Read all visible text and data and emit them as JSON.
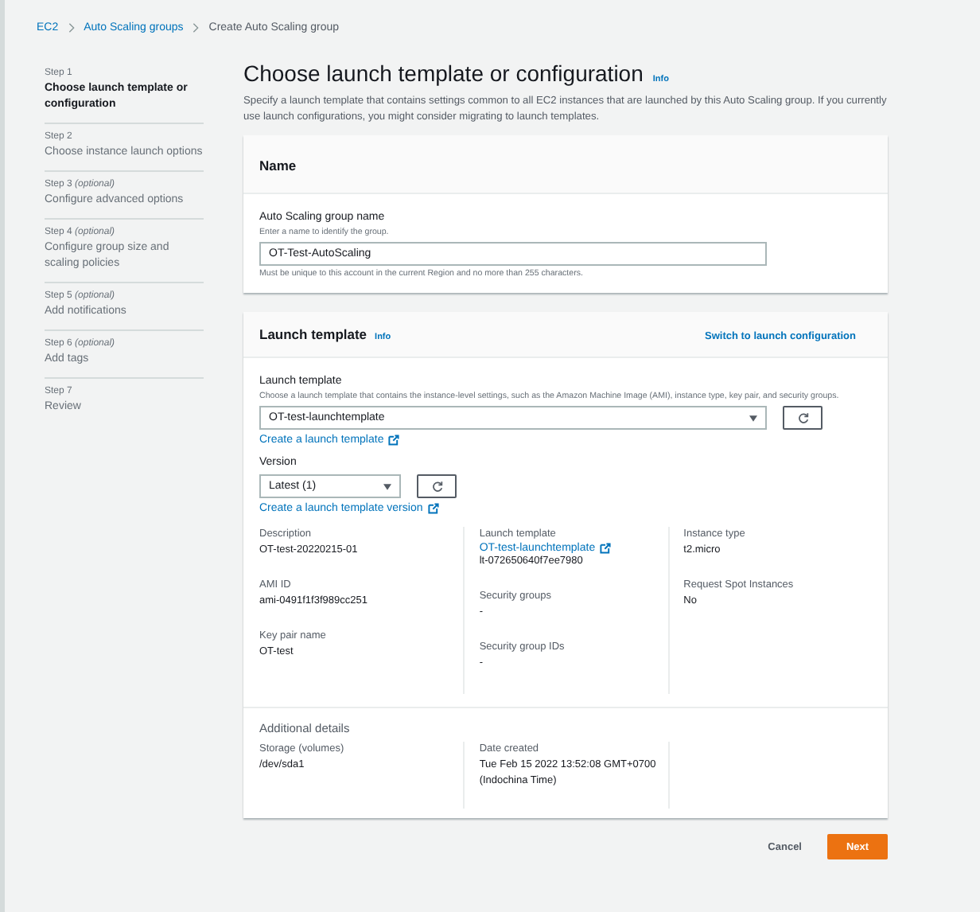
{
  "breadcrumb": [
    {
      "label": "EC2",
      "kind": "link"
    },
    {
      "label": "Auto Scaling groups",
      "kind": "link"
    },
    {
      "label": "Create Auto Scaling group",
      "kind": "current"
    }
  ],
  "steps": [
    {
      "step": "Step 1",
      "title": "Choose launch template or configuration",
      "selected": true
    },
    {
      "step": "Step 2",
      "title": "Choose instance launch options",
      "selected": false
    },
    {
      "step": "Step 3 *(optional)*",
      "title": "Configure advanced options",
      "selected": false
    },
    {
      "step": "Step 4 *(optional)*",
      "title": "Configure group size and scaling policies",
      "selected": false
    },
    {
      "step": "Step 5 *(optional)*",
      "title": "Add notifications",
      "selected": false
    },
    {
      "step": "Step 6 *(optional)*",
      "title": "Add tags",
      "selected": false
    },
    {
      "step": "Step 7",
      "title": "Review",
      "selected": false
    }
  ],
  "page": {
    "title": "Choose launch template or configuration",
    "info": "Info",
    "description": "Specify a launch template that contains settings common to all EC2 instances that are launched by this Auto Scaling group. If you currently use launch configurations, you might consider migrating to launch templates."
  },
  "name_card": {
    "title": "Name",
    "label": "Auto Scaling group name",
    "hint": "Enter a name to identify the group.",
    "value": "OT-Test-AutoScaling",
    "constraint": "Must be unique to this account in the current Region and no more than 255 characters."
  },
  "template_card": {
    "title": "Launch template",
    "info": "Info",
    "switch_link": "Switch to launch configuration",
    "template_label": "Launch template",
    "template_hint": "Choose a launch template that contains the instance-level settings, such as the Amazon Machine Image (AMI), instance type, key pair, and security groups.",
    "template_value": "OT-test-launchtemplate",
    "create_link": "Create a launch template",
    "version_label": "Version",
    "version_value": "Latest (1)",
    "version_link": "Create a launch template version",
    "details": [
      [
        {
          "label": "Description",
          "value": "OT-test-20220215-01",
          "kind": "text"
        },
        {
          "label": "AMI ID",
          "value": "ami-0491f1f3f989cc251",
          "kind": "text"
        },
        {
          "label": "Key pair name",
          "value": "OT-test",
          "kind": "text"
        }
      ],
      [
        {
          "label": "Launch template",
          "value": "OT-test-launchtemplate",
          "sub": "lt-072650640f7ee7980",
          "kind": "link"
        },
        {
          "label": "Security groups",
          "value": "-",
          "kind": "text"
        },
        {
          "label": "Security group IDs",
          "value": "-",
          "kind": "text"
        }
      ],
      [
        {
          "label": "Instance type",
          "value": "t2.micro",
          "kind": "text"
        },
        {
          "label": "Request Spot Instances",
          "value": "No",
          "kind": "text"
        }
      ]
    ],
    "additional_title": "Additional details",
    "additional": [
      [
        {
          "label": "Storage (volumes)",
          "value": "/dev/sda1"
        }
      ],
      [
        {
          "label": "Date created",
          "value": "Tue Feb 15 2022 13:52:08 GMT+0700 (Indochina Time)"
        }
      ]
    ]
  },
  "footer": {
    "cancel": "Cancel",
    "next": "Next"
  }
}
